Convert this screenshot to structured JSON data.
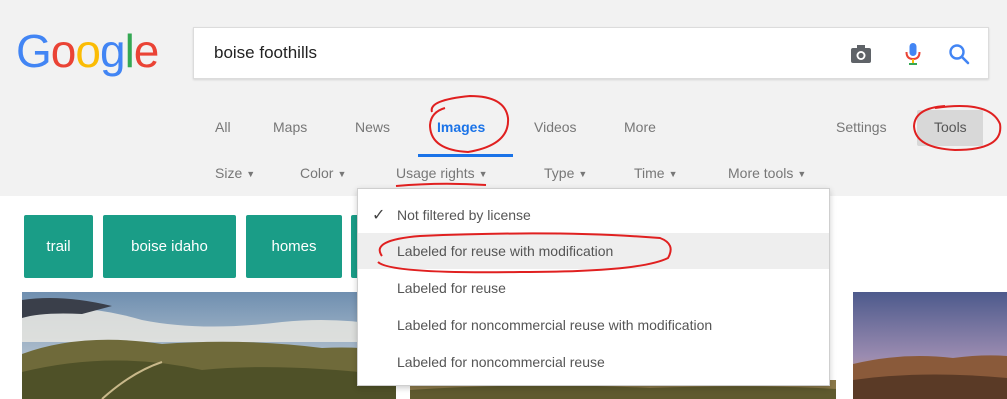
{
  "logo": {
    "letters": [
      "G",
      "o",
      "o",
      "g",
      "l",
      "e"
    ],
    "colors": [
      "#4285f4",
      "#ea4335",
      "#fbbc05",
      "#4285f4",
      "#34a853",
      "#ea4335"
    ]
  },
  "search": {
    "query": "boise foothills",
    "icons": [
      "camera-icon",
      "microphone-icon",
      "search-icon"
    ]
  },
  "nav": {
    "tabs": [
      "All",
      "Maps",
      "News",
      "Images",
      "Videos",
      "More"
    ],
    "active": "Images",
    "settings": "Settings",
    "tools": "Tools"
  },
  "tools": {
    "size": "Size",
    "color": "Color",
    "usage_rights": "Usage rights",
    "type": "Type",
    "time": "Time",
    "more_tools": "More tools"
  },
  "chips": [
    "trail",
    "boise idaho",
    "homes"
  ],
  "dropdown": {
    "items": [
      "Not filtered by license",
      "Labeled for reuse with modification",
      "Labeled for reuse",
      "Labeled for noncommercial reuse with modification",
      "Labeled for noncommercial reuse"
    ],
    "checked_index": 0,
    "highlighted_index": 1
  },
  "colors": {
    "accent": "#1a73e8",
    "chip": "#1a9d87",
    "annotation": "#e02020"
  }
}
